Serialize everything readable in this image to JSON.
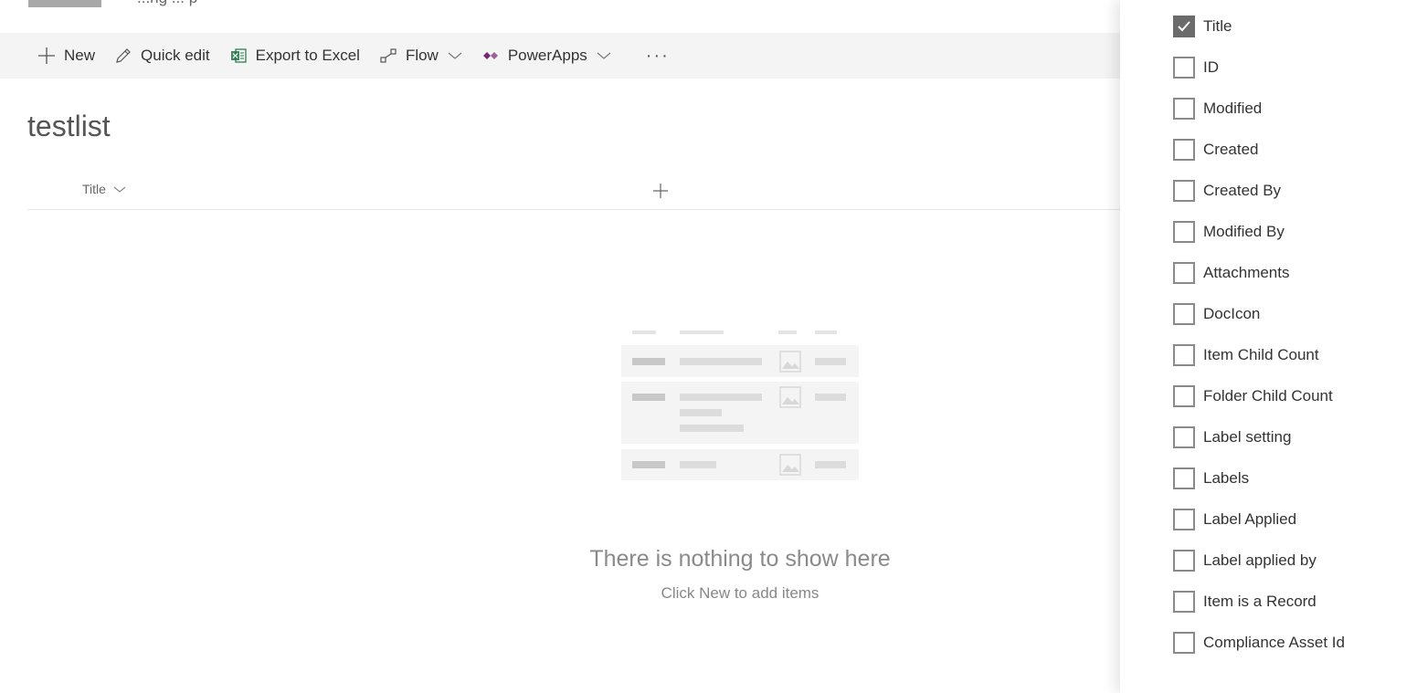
{
  "header": {
    "site_name": "...ng ... p"
  },
  "toolbar": {
    "new_label": "New",
    "quick_edit_label": "Quick edit",
    "export_label": "Export to Excel",
    "flow_label": "Flow",
    "powerapps_label": "PowerApps",
    "more_label": "···"
  },
  "list": {
    "title": "testlist",
    "column_title": "Title",
    "empty_title": "There is nothing to show here",
    "empty_subtitle": "Click New to add items"
  },
  "panel": {
    "columns": [
      {
        "label": "Title",
        "checked": true
      },
      {
        "label": "ID",
        "checked": false
      },
      {
        "label": "Modified",
        "checked": false
      },
      {
        "label": "Created",
        "checked": false
      },
      {
        "label": "Created By",
        "checked": false
      },
      {
        "label": "Modified By",
        "checked": false
      },
      {
        "label": "Attachments",
        "checked": false
      },
      {
        "label": "DocIcon",
        "checked": false
      },
      {
        "label": "Item Child Count",
        "checked": false
      },
      {
        "label": "Folder Child Count",
        "checked": false
      },
      {
        "label": "Label setting",
        "checked": false
      },
      {
        "label": "Labels",
        "checked": false
      },
      {
        "label": "Label Applied",
        "checked": false
      },
      {
        "label": "Label applied by",
        "checked": false
      },
      {
        "label": "Item is a Record",
        "checked": false
      },
      {
        "label": "Compliance Asset Id",
        "checked": false
      }
    ]
  },
  "colors": {
    "excel": "#217346",
    "powerapps": "#742774",
    "checkbox_checked": "#6b6b6b"
  }
}
